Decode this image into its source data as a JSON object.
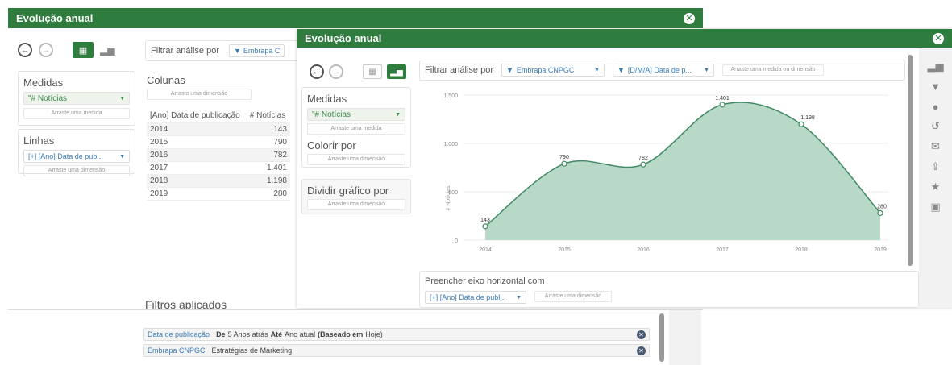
{
  "back_window": {
    "title": "Evolução anual",
    "filter_label": "Filtrar análise por",
    "filter_pill": "Embrapa C",
    "medidas_title": "Medidas",
    "medidas_pill": "\"# Notícias",
    "medidas_drop": "Arraste uma medida",
    "linhas_title": "Linhas",
    "linhas_pill": "[+] [Ano] Data de pub...",
    "linhas_drop": "Arraste uma dimensão",
    "colunas_title": "Colunas",
    "colunas_drop": "Arraste uma dimensão",
    "table": {
      "headers": [
        "[Ano] Data de publicação",
        "# Notícias"
      ],
      "rows": [
        [
          "2014",
          "143"
        ],
        [
          "2015",
          "790"
        ],
        [
          "2016",
          "782"
        ],
        [
          "2017",
          "1.401"
        ],
        [
          "2018",
          "1.198"
        ],
        [
          "2019",
          "280"
        ]
      ]
    },
    "filtros_title": "Filtros aplicados",
    "filtros": [
      {
        "field": "Data de publicação",
        "sep": "De",
        "rest1": "5 Anos atrás",
        "bold1": "Até",
        "rest2": "Ano atual",
        "bold2": "(Baseado em",
        "rest3": "Hoje)"
      },
      {
        "field": "Embrapa CNPGC",
        "rest": "Estratégias de Marketing"
      }
    ]
  },
  "front_window": {
    "title": "Evolução anual",
    "filter_label": "Filtrar análise por",
    "filter_pill_1": "Embrapa CNPGC",
    "filter_pill_2": "[D/M/A] Data de p...",
    "filter_drop": "Arraste uma medida ou dimensão",
    "medidas_title": "Medidas",
    "medidas_pill": "\"# Notícias",
    "medidas_drop": "Arraste uma medida",
    "colorir_title": "Colorir por",
    "colorir_drop": "Arraste uma dimensão",
    "dividir_title": "Dividir gráfico por",
    "dividir_drop": "Arraste uma dimensão",
    "preencher_title": "Preencher eixo horizontal com",
    "preencher_pill": "[+] [Ano] Data de publ...",
    "preencher_drop": "Arraste uma dimensão"
  },
  "colors": {
    "header_green": "#2e7d3e",
    "area_fill": "#b9d9c8",
    "line": "#3f8a63"
  },
  "chart_data": {
    "type": "area",
    "categories": [
      "2014",
      "2015",
      "2016",
      "2017",
      "2018",
      "2019"
    ],
    "values": [
      143,
      790,
      782,
      1401,
      1198,
      280
    ],
    "labels": [
      "143",
      "790",
      "782",
      "1.401",
      "1.198",
      "280"
    ],
    "ylabel": "# Notícias",
    "yticks": [
      "0",
      "500",
      "1.000",
      "1.500"
    ],
    "ylim": [
      0,
      1500
    ]
  }
}
